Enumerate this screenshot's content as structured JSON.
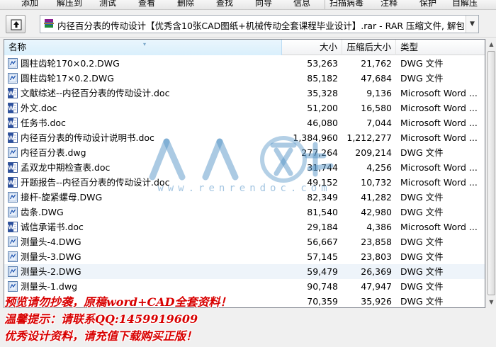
{
  "toolbar": {
    "buttons": [
      "添加",
      "解压到",
      "测试",
      "查看",
      "删除",
      "查找",
      "向导",
      "信息",
      "扫描病毒",
      "注释",
      "保护",
      "自解压"
    ]
  },
  "address": {
    "path": "内径百分表的传动设计【优秀含10张CAD图纸+机械传动全套课程毕业设计】.rar - RAR 压缩文件, 解包大小为"
  },
  "columns": {
    "name": "名称",
    "size": "大小",
    "packed": "压缩后大小",
    "type": "类型"
  },
  "files": [
    {
      "name": "圆柱齿轮170×0.2.DWG",
      "size": "53,263",
      "packed": "21,762",
      "type": "DWG 文件",
      "icon": "dwg"
    },
    {
      "name": "圆柱齿轮17×0.2.DWG",
      "size": "85,182",
      "packed": "47,684",
      "type": "DWG 文件",
      "icon": "dwg"
    },
    {
      "name": "文献综述--内径百分表的传动设计.doc",
      "size": "35,328",
      "packed": "9,136",
      "type": "Microsoft Word ...",
      "icon": "doc"
    },
    {
      "name": "外文.doc",
      "size": "51,200",
      "packed": "16,580",
      "type": "Microsoft Word ...",
      "icon": "doc"
    },
    {
      "name": "任务书.doc",
      "size": "46,080",
      "packed": "7,044",
      "type": "Microsoft Word ...",
      "icon": "doc"
    },
    {
      "name": "内径百分表的传动设计说明书.doc",
      "size": "1,384,960",
      "packed": "1,212,277",
      "type": "Microsoft Word ...",
      "icon": "doc"
    },
    {
      "name": "内径百分表.dwg",
      "size": "277,264",
      "packed": "209,214",
      "type": "DWG 文件",
      "icon": "dwg"
    },
    {
      "name": "孟双龙中期检查表.doc",
      "size": "31,744",
      "packed": "4,256",
      "type": "Microsoft Word ...",
      "icon": "doc"
    },
    {
      "name": "开题报告--内径百分表的传动设计.doc",
      "size": "49,152",
      "packed": "10,732",
      "type": "Microsoft Word ...",
      "icon": "doc"
    },
    {
      "name": "接杆-旋紧螺母.DWG",
      "size": "82,349",
      "packed": "41,282",
      "type": "DWG 文件",
      "icon": "dwg"
    },
    {
      "name": "齿条.DWG",
      "size": "81,540",
      "packed": "42,980",
      "type": "DWG 文件",
      "icon": "dwg"
    },
    {
      "name": "诚信承诺书.doc",
      "size": "29,184",
      "packed": "4,386",
      "type": "Microsoft Word ...",
      "icon": "doc"
    },
    {
      "name": "测量头-4.DWG",
      "size": "56,667",
      "packed": "23,858",
      "type": "DWG 文件",
      "icon": "dwg"
    },
    {
      "name": "测量头-3.DWG",
      "size": "57,145",
      "packed": "23,803",
      "type": "DWG 文件",
      "icon": "dwg"
    },
    {
      "name": "测量头-2.DWG",
      "size": "59,479",
      "packed": "26,369",
      "type": "DWG 文件",
      "icon": "dwg",
      "selected": true
    },
    {
      "name": "测量头-1.dwg",
      "size": "90,748",
      "packed": "47,947",
      "type": "DWG 文件",
      "icon": "dwg"
    },
    {
      "name": "",
      "size": "70,359",
      "packed": "35,926",
      "type": "DWG 文件",
      "icon": "dwg"
    }
  ],
  "watermark": {
    "url": "www.renrendoc.com"
  },
  "overlay": {
    "line1": "预览请勿抄袭，原稿word+CAD全套资料！",
    "line2": "温馨提示：请联系QQ:1459919609",
    "line3": "优秀设计资料，请充值下载购买正版！"
  },
  "colors": {
    "overlay_text": "#d80000",
    "header_active": "#d9effc",
    "selected_row": "#eef4fa"
  }
}
